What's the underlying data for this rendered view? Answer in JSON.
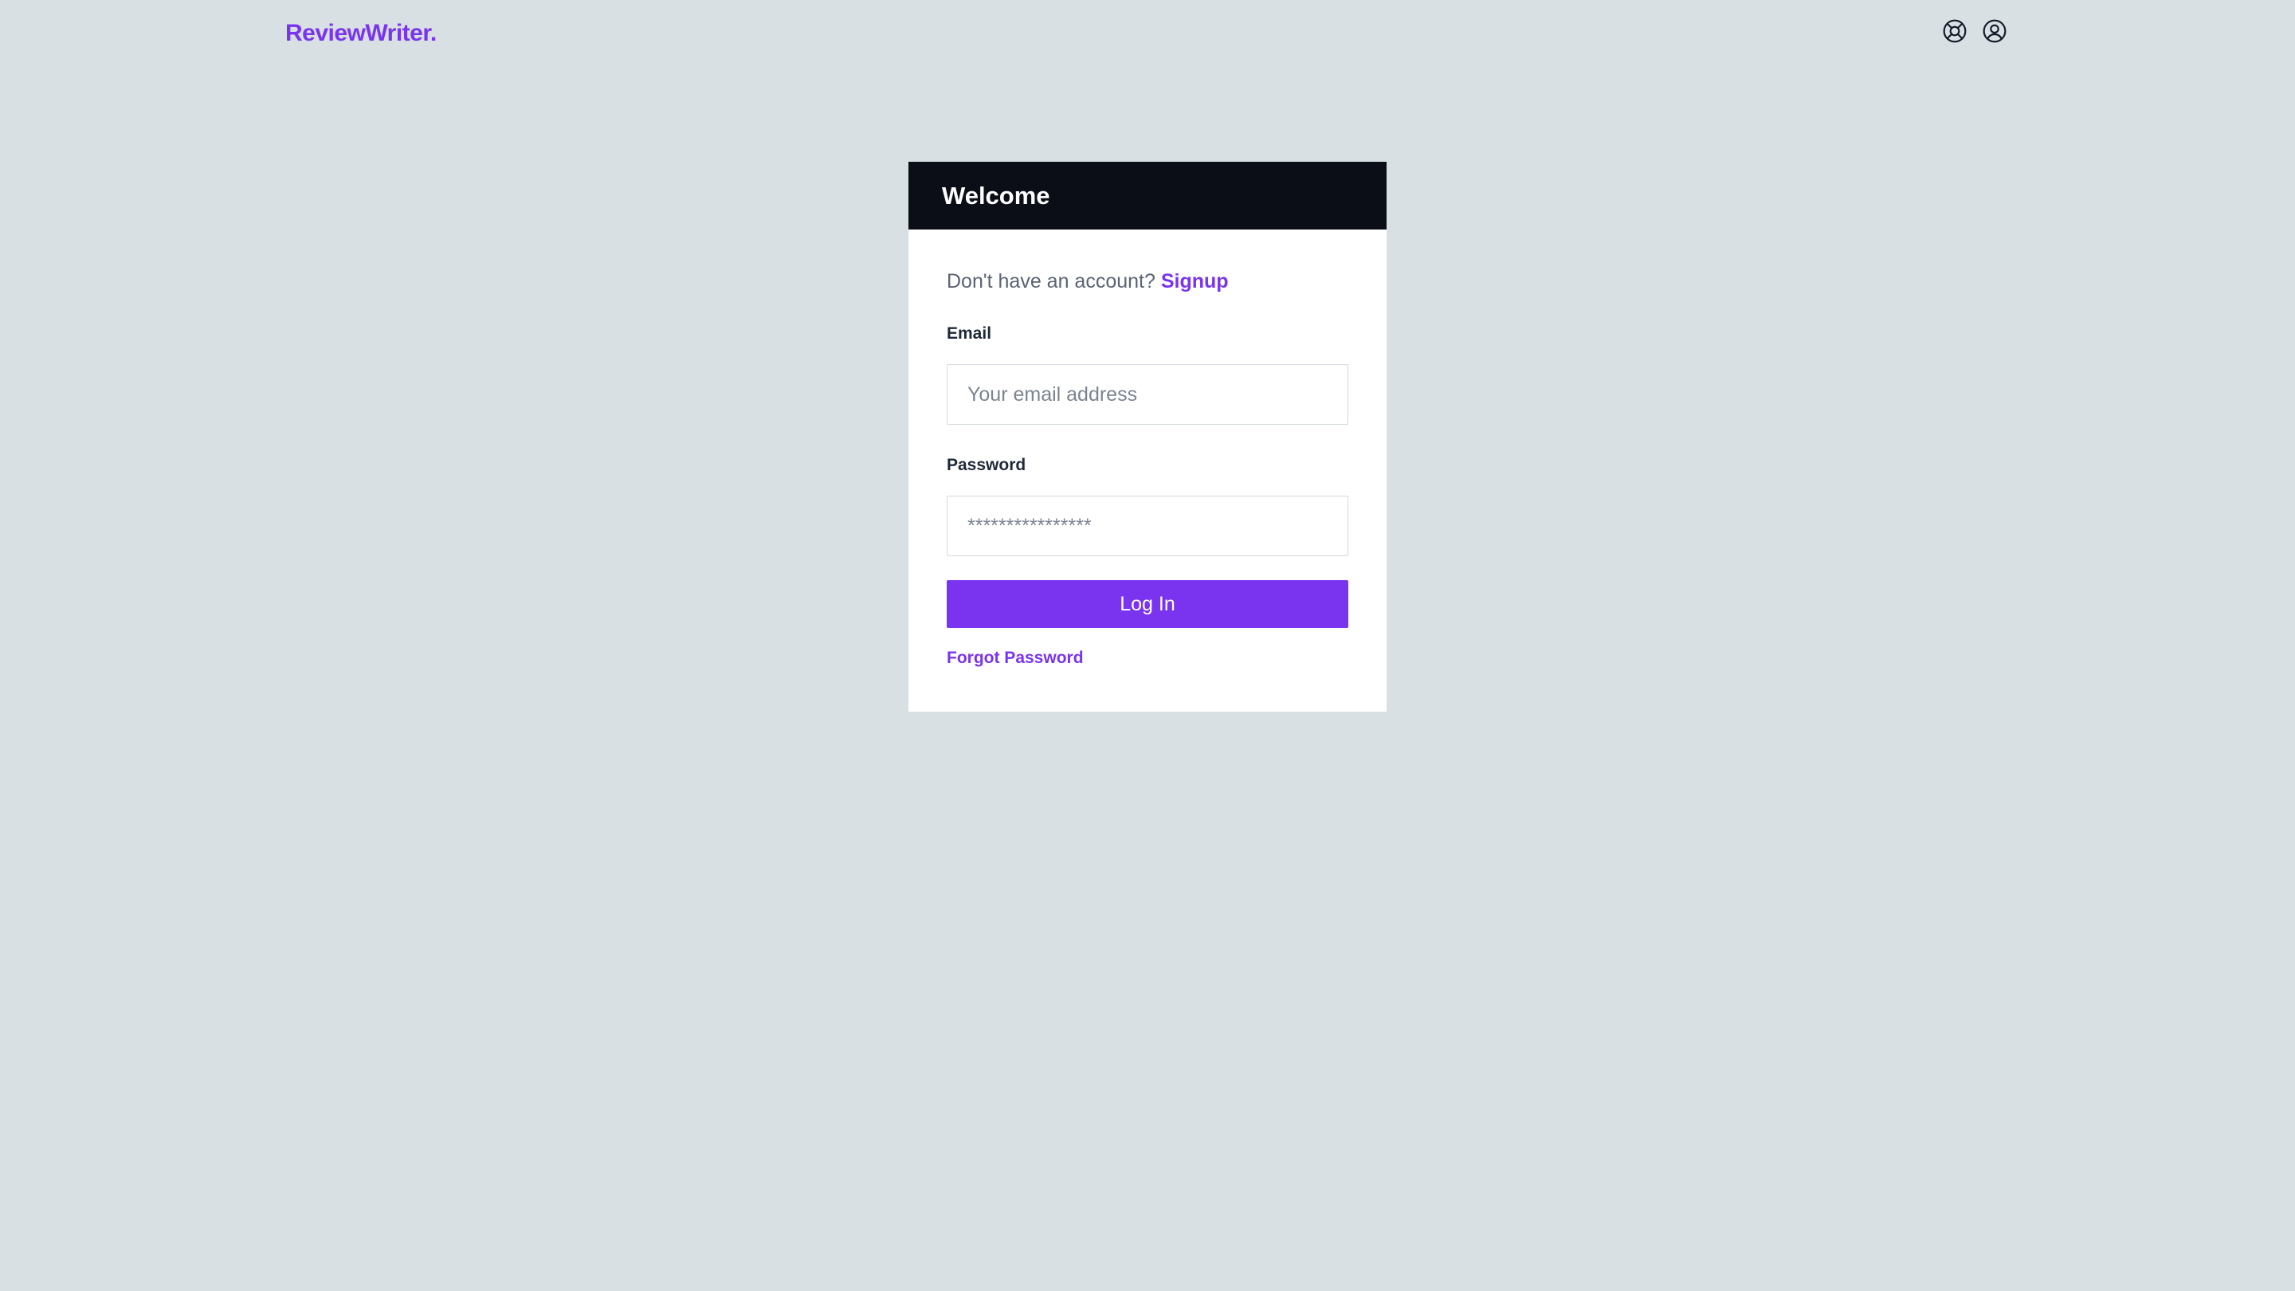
{
  "header": {
    "logo": "ReviewWriter.",
    "icons": [
      "help-icon",
      "user-account-icon"
    ]
  },
  "login": {
    "title": "Welcome",
    "signup_prompt": "Don't have an account?",
    "signup_link": "Signup",
    "email_label": "Email",
    "email_placeholder": "Your email address",
    "email_value": "",
    "password_label": "Password",
    "password_placeholder": "****************",
    "password_value": "",
    "login_button": "Log In",
    "forgot_password": "Forgot Password"
  },
  "colors": {
    "background": "#d8e0e3",
    "accent": "#7a34f0",
    "header_dark": "#0b0e17"
  }
}
